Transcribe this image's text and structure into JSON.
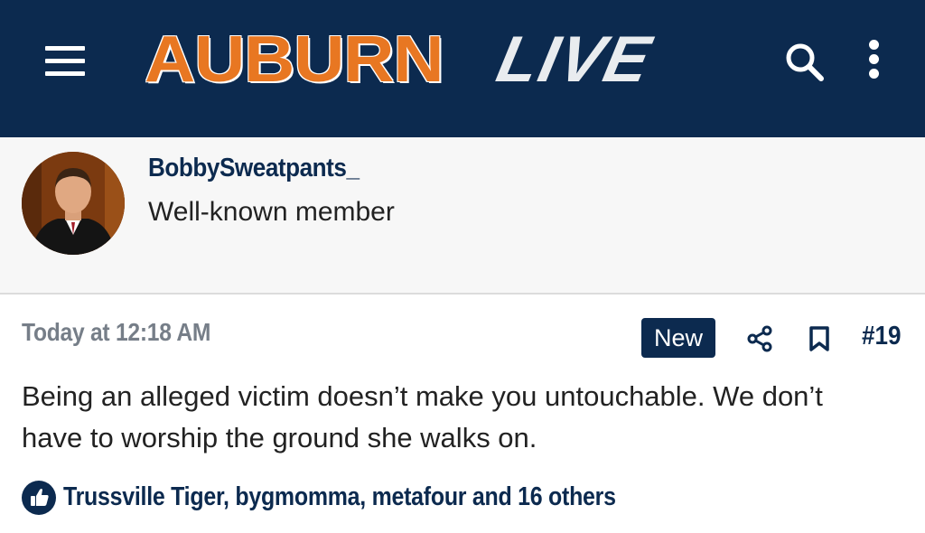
{
  "header": {
    "logo_primary": "AUBURN",
    "logo_secondary": "LIVE",
    "icons": [
      "menu-icon",
      "search-icon",
      "more-vertical-icon"
    ]
  },
  "author": {
    "username": "BobbySweatpants_",
    "title": "Well-known member"
  },
  "post": {
    "timestamp": "Today at 12:18 AM",
    "badge": "New",
    "number": "#19",
    "body": "Being an alleged victim doesn’t make you untouchable. We don’t have to worship the ground she walks on.",
    "reactions": "Trussville Tiger, bygmomma, metafour and 16 others"
  },
  "colors": {
    "navy": "#0c2a4f",
    "orange": "#e87722",
    "muted": "#767e88",
    "author_bg": "#f7f7f7"
  }
}
